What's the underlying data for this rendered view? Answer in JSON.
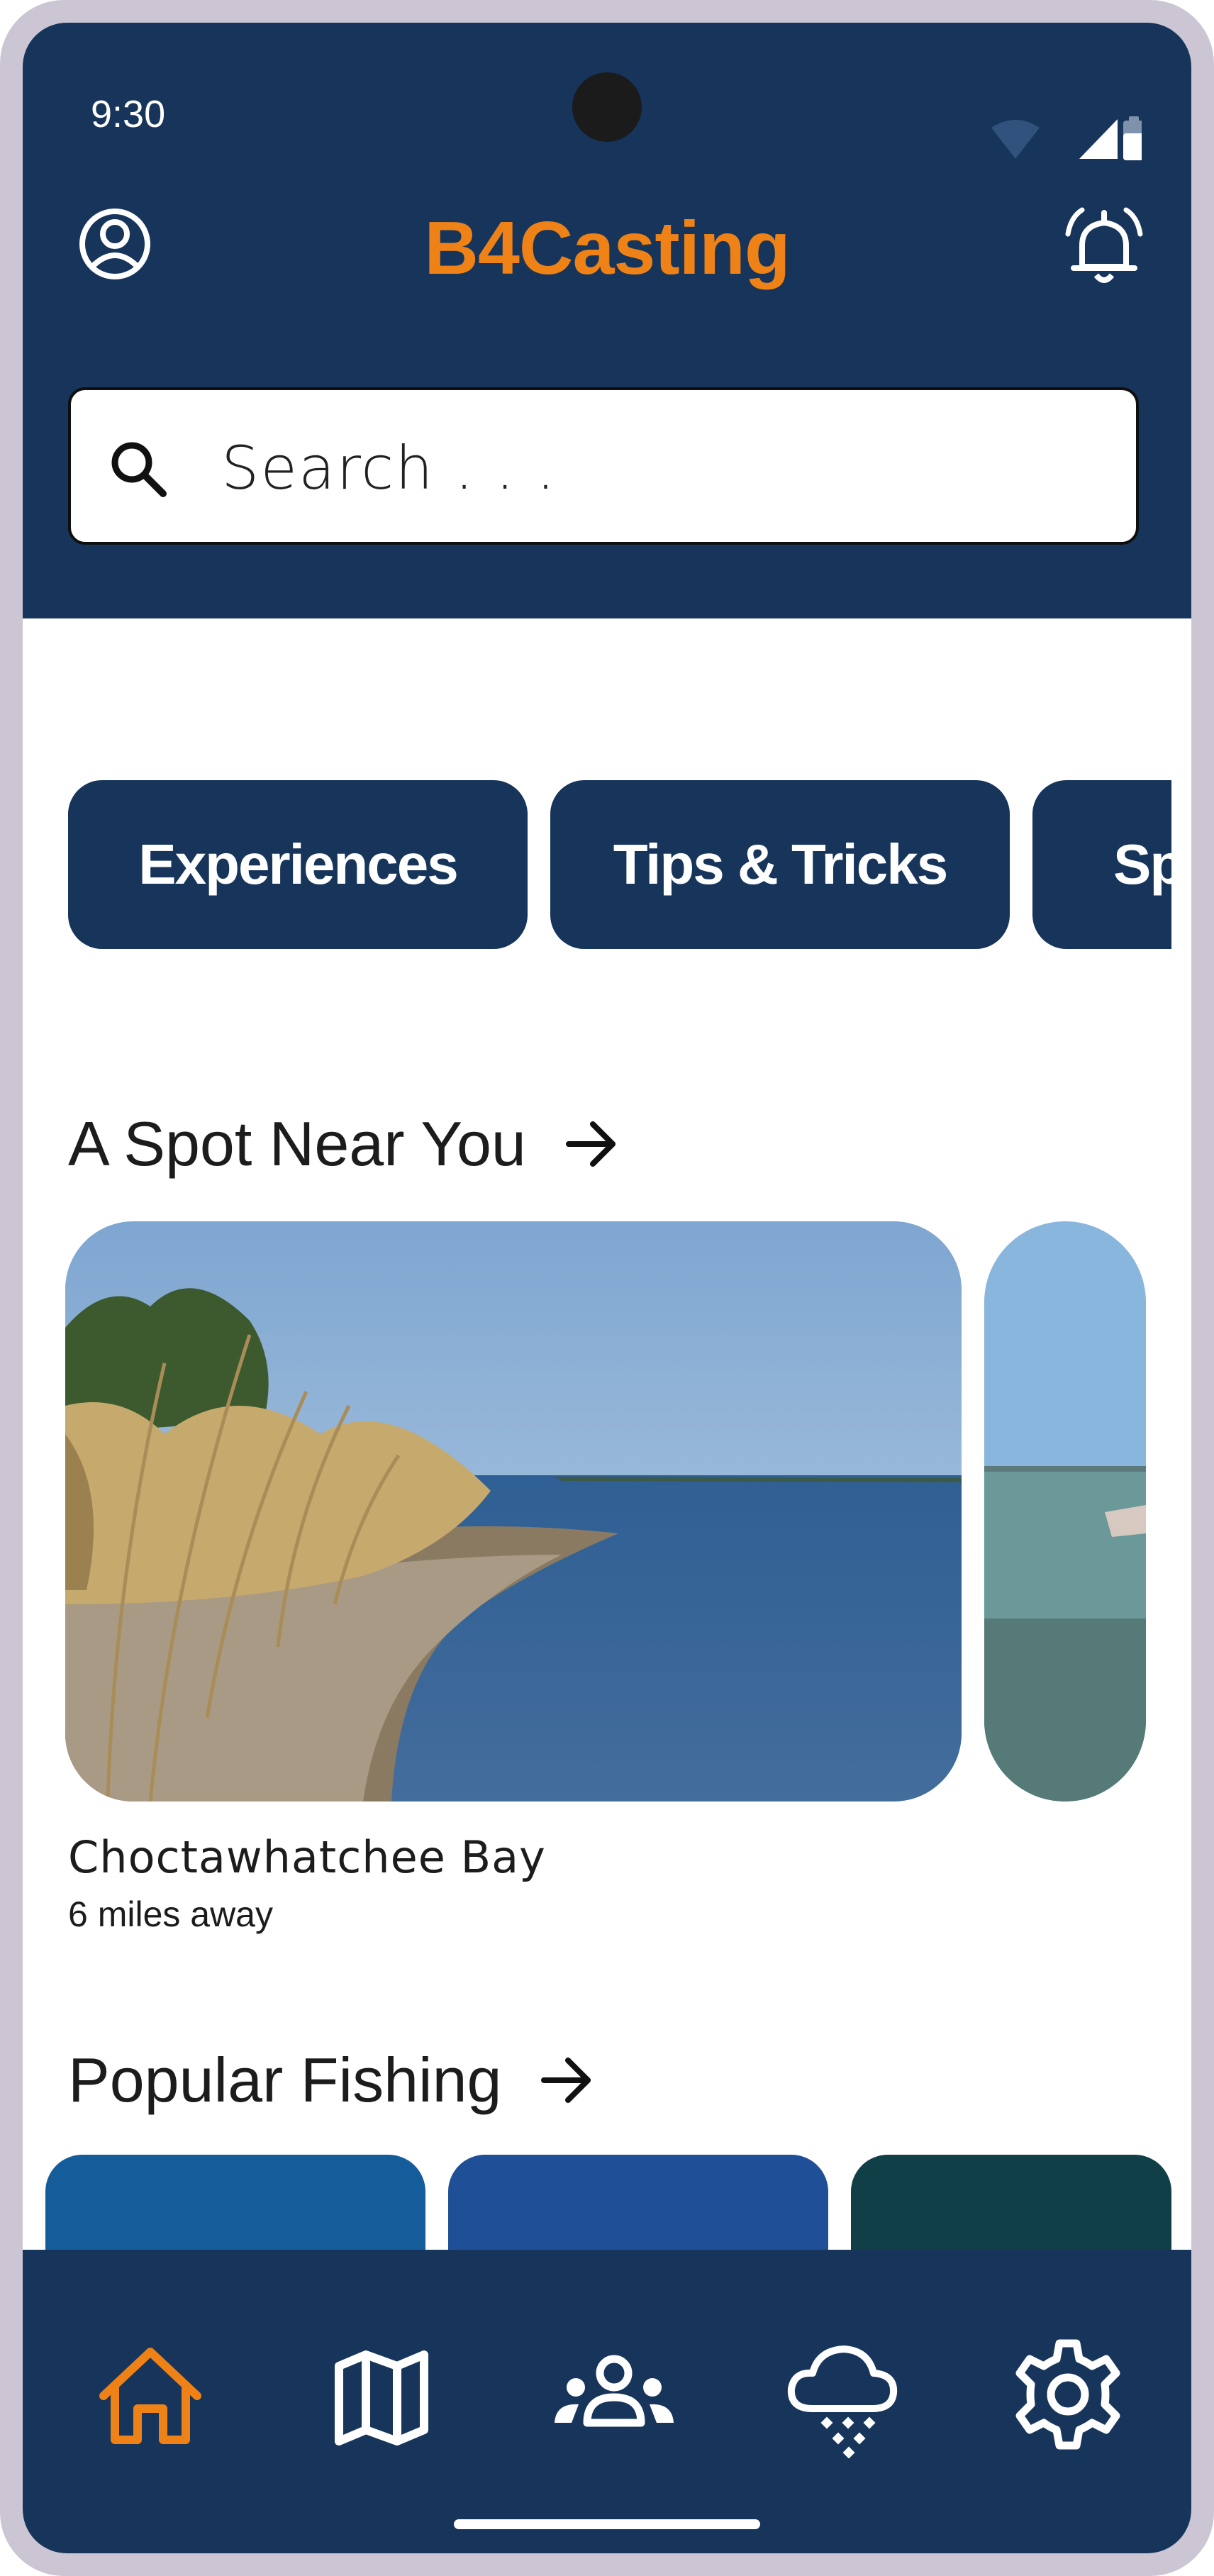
{
  "status_bar": {
    "time": "9:30"
  },
  "header": {
    "title": "B4Casting"
  },
  "search": {
    "placeholder": "Search . . ."
  },
  "categories": [
    "Experiences",
    "Tips & Tricks",
    "Sp"
  ],
  "spot_section": {
    "title": "A Spot Near You",
    "spot_name": "Choctawhatchee Bay",
    "spot_distance": "6 miles away"
  },
  "popular_section": {
    "title": "Popular Fishing"
  },
  "nav": {
    "active": "home",
    "items": [
      "home-icon",
      "map-icon",
      "community-icon",
      "weather-icon",
      "settings-icon"
    ]
  },
  "colors": {
    "primary": "#17355b",
    "accent": "#ef8216",
    "frame": "#ccc6d4"
  }
}
